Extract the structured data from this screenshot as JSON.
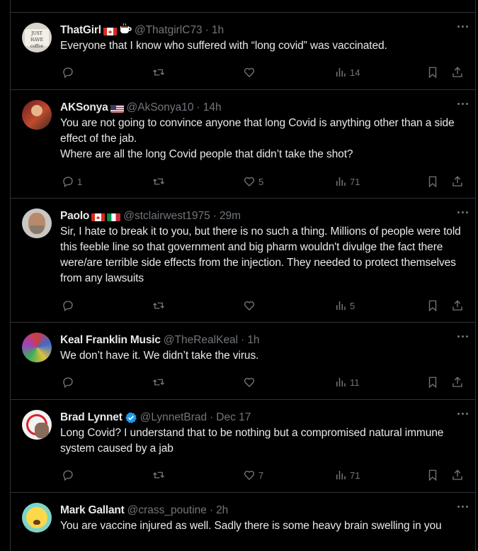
{
  "tweets": [
    {
      "name": "ThatGirl",
      "handle": "@ThatgirlC73",
      "time": "1h",
      "text": "Everyone that I know who suffered with “long covid” was vaccinated.",
      "replies": "",
      "likes": "",
      "views": "14",
      "avatar_text": "JUST HAVE coffee"
    },
    {
      "name": "AKSonya",
      "handle": "@AkSonya10",
      "time": "14h",
      "text": "You are not going to convince anyone that long Covid is anything other than a side effect of the jab.\nWhere are all the long Covid people that didn’t take the shot?",
      "replies": "1",
      "likes": "5",
      "views": "71"
    },
    {
      "name": "Paolo",
      "handle": "@stclairwest1975",
      "time": "29m",
      "text": "Sir, I hate to break it to you, but there is no such a thing. Millions of people were told this feeble line so that government and big pharm wouldn't divulge the fact there were/are terrible side effects from the injection. They needed to protect themselves from any lawsuits",
      "replies": "",
      "likes": "",
      "views": "5"
    },
    {
      "name": "Keal Franklin Music",
      "handle": "@TheRealKeal",
      "time": "1h",
      "text": "We don’t have it. We didn’t take the virus.",
      "replies": "",
      "likes": "",
      "views": "11"
    },
    {
      "name": "Brad Lynnet",
      "handle": "@LynnetBrad",
      "time": "Dec 17",
      "text": "Long Covid? I understand that to be nothing but a compromised natural immune system caused by a jab",
      "replies": "",
      "likes": "7",
      "views": "71"
    },
    {
      "name": "Mark Gallant",
      "handle": "@crass_poutine",
      "time": "2h",
      "text": "You are vaccine injured as well. Sadly there is some heavy brain swelling in you",
      "replies": "",
      "likes": "",
      "views": ""
    }
  ],
  "colors": {
    "background": "#000000",
    "text": "#e7e9ea",
    "muted": "#71767b",
    "border": "#2f3336",
    "verified": "#1d9bf0"
  },
  "icons": [
    "more-icon",
    "reply-icon",
    "retweet-icon",
    "like-icon",
    "views-icon",
    "bookmark-icon",
    "share-icon",
    "verified-icon",
    "canada-flag-icon",
    "usa-flag-icon",
    "italy-flag-icon",
    "coffee-icon"
  ]
}
